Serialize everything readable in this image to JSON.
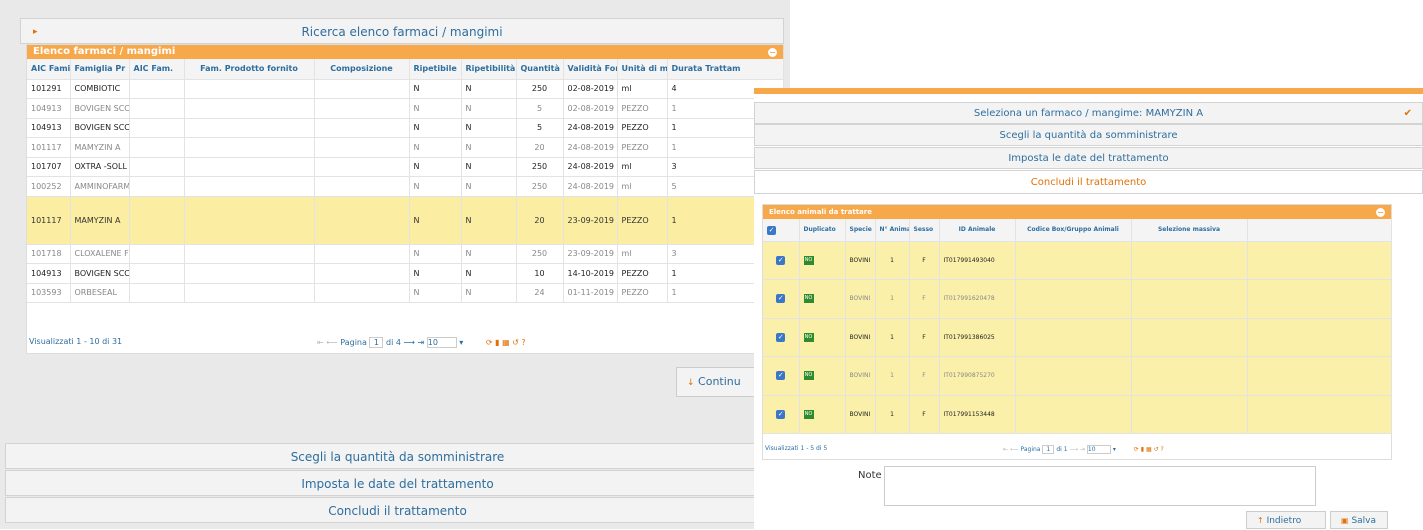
{
  "left": {
    "search_header": "Ricerca elenco farmaci / mangimi",
    "panel_title": "Elenco farmaci / mangimi",
    "columns": [
      "AIC Famiglia",
      "Famiglia Pr",
      "AIC Fam.",
      "Fam. Prodotto fornito",
      "Composizione",
      "Ripetibile",
      "Ripetibilità",
      "Quantità pr",
      "Validità For",
      "Unità di mis",
      "Durata Trattam"
    ],
    "rows": [
      {
        "aic": "101291",
        "fam": "COMBIOTIC",
        "rip": "N",
        "ripb": "N",
        "qty": "250",
        "val": "02-08-2019",
        "unit": "ml",
        "dur": "4",
        "style": "bold"
      },
      {
        "aic": "104913",
        "fam": "BOVIGEN SCC",
        "rip": "N",
        "ripb": "N",
        "qty": "5",
        "val": "02-08-2019",
        "unit": "PEZZO",
        "dur": "1",
        "style": "dim"
      },
      {
        "aic": "104913",
        "fam": "BOVIGEN SCC",
        "rip": "N",
        "ripb": "N",
        "qty": "5",
        "val": "24-08-2019",
        "unit": "PEZZO",
        "dur": "1",
        "style": "bold"
      },
      {
        "aic": "101117",
        "fam": "MAMYZIN A",
        "rip": "N",
        "ripb": "N",
        "qty": "20",
        "val": "24-08-2019",
        "unit": "PEZZO",
        "dur": "1",
        "style": "dim"
      },
      {
        "aic": "101707",
        "fam": "OXTRA -SOLL",
        "rip": "N",
        "ripb": "N",
        "qty": "250",
        "val": "24-08-2019",
        "unit": "ml",
        "dur": "3",
        "style": "bold"
      },
      {
        "aic": "100252",
        "fam": "AMMINOFARM",
        "rip": "N",
        "ripb": "N",
        "qty": "250",
        "val": "24-08-2019",
        "unit": "ml",
        "dur": "5",
        "style": "dim"
      },
      {
        "aic": "101117",
        "fam": "MAMYZIN A",
        "rip": "N",
        "ripb": "N",
        "qty": "20",
        "val": "23-09-2019",
        "unit": "PEZZO",
        "dur": "1",
        "style": "sel"
      },
      {
        "aic": "101718",
        "fam": "CLOXALENE F",
        "rip": "N",
        "ripb": "N",
        "qty": "250",
        "val": "23-09-2019",
        "unit": "ml",
        "dur": "3",
        "style": "dim"
      },
      {
        "aic": "104913",
        "fam": "BOVIGEN SCC",
        "rip": "N",
        "ripb": "N",
        "qty": "10",
        "val": "14-10-2019",
        "unit": "PEZZO",
        "dur": "1",
        "style": "bold"
      },
      {
        "aic": "103593",
        "fam": "ORBESEAL",
        "rip": "N",
        "ripb": "N",
        "qty": "24",
        "val": "01-11-2019",
        "unit": "PEZZO",
        "dur": "1",
        "style": "dim"
      }
    ],
    "visualized": "Visualizzati 1 - 10 di 31",
    "pager_label": "Pagina",
    "pager_page": "1",
    "pager_of": "di 4",
    "pager_size": "10",
    "continue_label": "Continu",
    "acc_qty": "Scegli la quantità da somministrare",
    "acc_dates": "Imposta le date del trattamento",
    "acc_end": "Concludi il trattamento"
  },
  "right": {
    "sel_header": "Seleziona un farmaco / mangime: MAMYZIN A",
    "acc_qty": "Scegli la quantità da somministrare",
    "acc_dates": "Imposta le date del trattamento",
    "acc_end": "Concludi il trattamento",
    "panel_title": "Elenco animali da trattare",
    "columns": [
      "",
      "Duplicato",
      "Specie",
      "N° Anima",
      "Sesso",
      "ID Animale",
      "Codice Box/Gruppo Animali",
      "Selezione massiva"
    ],
    "rows": [
      {
        "dup": "NO",
        "species": "BOVINI",
        "n": "1",
        "sex": "F",
        "id": "IT017991493040",
        "style": "bold"
      },
      {
        "dup": "NO",
        "species": "BOVINI",
        "n": "1",
        "sex": "F",
        "id": "IT017991620478",
        "style": "dim"
      },
      {
        "dup": "NO",
        "species": "BOVINI",
        "n": "1",
        "sex": "F",
        "id": "IT017991386025",
        "style": "bold"
      },
      {
        "dup": "NO",
        "species": "BOVINI",
        "n": "1",
        "sex": "F",
        "id": "IT017990875270",
        "style": "dim"
      },
      {
        "dup": "NO",
        "species": "BOVINI",
        "n": "1",
        "sex": "F",
        "id": "IT017991153448",
        "style": "bold"
      }
    ],
    "visualized": "Visualizzati 1 - 5 di 5",
    "pager_label": "Pagina",
    "pager_page": "1",
    "pager_of": "di 1",
    "pager_size": "10",
    "note_label": "Note",
    "back_label": "Indietro",
    "save_label": "Salva"
  }
}
